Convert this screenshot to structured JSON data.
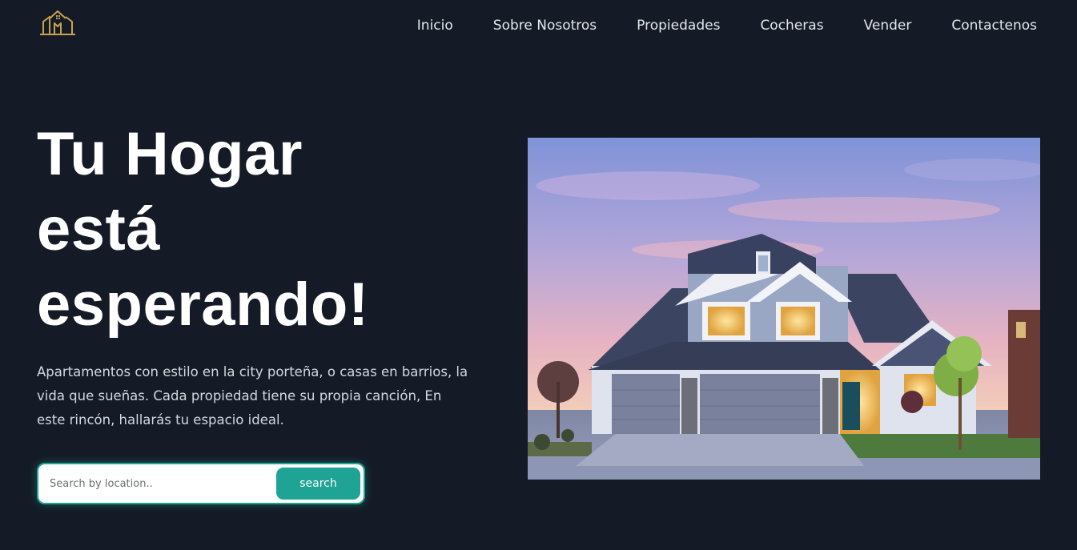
{
  "header": {
    "logo_icon": "house-logo-icon",
    "nav": [
      {
        "label": "Inicio"
      },
      {
        "label": "Sobre Nosotros"
      },
      {
        "label": "Propiedades"
      },
      {
        "label": "Cocheras"
      },
      {
        "label": "Vender"
      },
      {
        "label": "Contactenos"
      }
    ]
  },
  "hero": {
    "title_lines": [
      "Tu Hogar",
      "está",
      "esperando!"
    ],
    "description": "Apartamentos con estilo en la city porteña, o casas en barrios, la vida que sueñas. Cada propiedad tiene su propia canción, En este rincón, hallarás tu espacio ideal.",
    "search": {
      "placeholder": "Search by location..",
      "value": "",
      "button_label": "search"
    },
    "image": {
      "icon": "house-photo"
    }
  },
  "colors": {
    "background": "#141b26",
    "accent": "#1fa394",
    "logo": "#c9a24e",
    "text": "#ffffff"
  }
}
